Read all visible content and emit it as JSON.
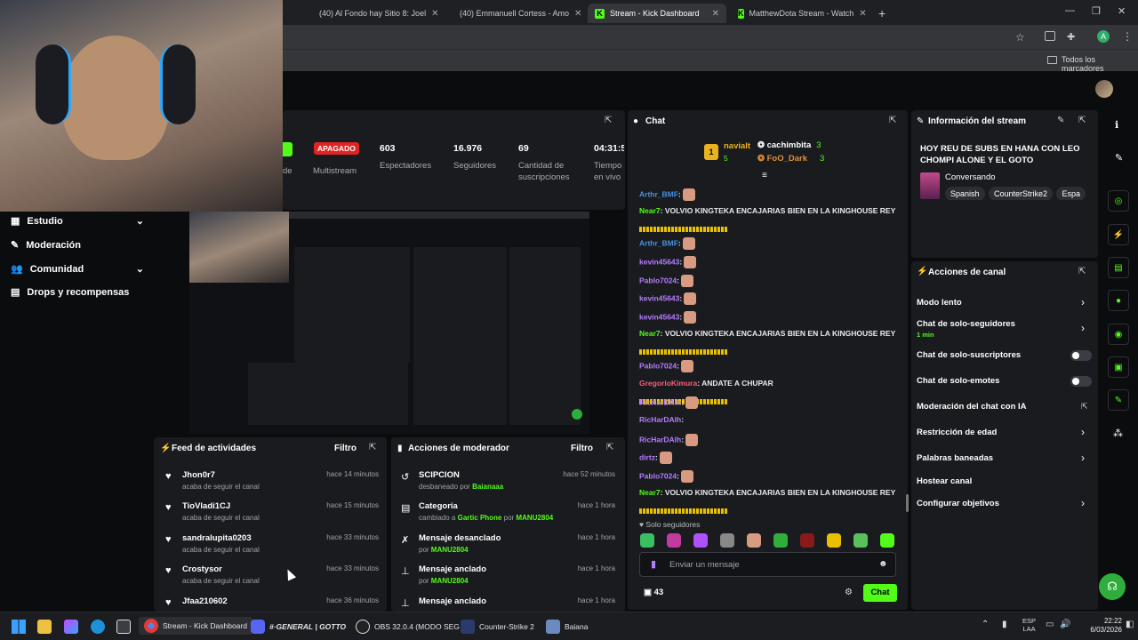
{
  "browser": {
    "tabs": [
      {
        "label": "(40) Al Fondo hay Sitio 8: Joel",
        "icon": "youtube-icon"
      },
      {
        "label": "(40) Emmanuell Cortess - Amo",
        "icon": "youtube-icon"
      },
      {
        "label": "Stream - Kick Dashboard",
        "icon": "kick-icon"
      },
      {
        "label": "MatthewDota Stream - Watch",
        "icon": "kick-icon"
      }
    ],
    "new_tab": "+",
    "bookmarks_label": "Todos los marcadores",
    "profile_initial": "A"
  },
  "stats": {
    "status_badge": "APAGADO",
    "multistream_label": "Multistream",
    "partial_label": "de",
    "viewers_value": "603",
    "viewers_label": "Espectadores",
    "followers_value": "16.976",
    "followers_label": "Seguidores",
    "subs_value": "69",
    "subs_label": "Cantidad de suscripciones",
    "time_value": "04:31:5",
    "time_label": "Tiempo en vivo"
  },
  "sidebar": {
    "items": [
      {
        "label": "Estudio",
        "icon": "studio-icon",
        "chevron": "⌄"
      },
      {
        "label": "Moderación",
        "icon": "wrench-icon"
      },
      {
        "label": "Comunidad",
        "icon": "people-icon",
        "chevron": "⌄"
      },
      {
        "label": "Drops y recompensas",
        "icon": "gift-icon"
      }
    ]
  },
  "chat": {
    "title": "Chat",
    "leaderboard": [
      {
        "rank": "1",
        "name": "navialt",
        "count": "5"
      },
      {
        "name": "cachimbita",
        "count": "3"
      },
      {
        "name": "FoO_Dark",
        "count": "3"
      }
    ],
    "messages": [
      {
        "user": "Arthr_BMF",
        "color": "#4a90e2",
        "text": ":",
        "emote": "hand"
      },
      {
        "user": "Near7",
        "color": "#53fc18",
        "text": ": VOLVIO KINGTEKA ENCAJARIAS BIEN EN LA KINGHOUSE REY"
      },
      {
        "user": "Arthr_BMF",
        "color": "#4a90e2",
        "text": ":",
        "emote": "hand"
      },
      {
        "user": "kevin45643",
        "color": "#b57cff",
        "text": ":",
        "emote": "hand"
      },
      {
        "user": "Pablo7024",
        "color": "#b57cff",
        "text": ":",
        "emote": "hand"
      },
      {
        "user": "kevin45643",
        "color": "#b57cff",
        "text": ":",
        "emote": "hand"
      },
      {
        "user": "kevin45643",
        "color": "#b57cff",
        "text": ":",
        "emote": "hand"
      },
      {
        "user": "Near7",
        "color": "#53fc18",
        "text": ": VOLVIO KINGTEKA ENCAJARIAS BIEN EN LA KINGHOUSE REY"
      },
      {
        "user": "Pablo7024",
        "color": "#b57cff",
        "text": ":",
        "emote": "hand"
      },
      {
        "user": "GregorioKimura",
        "color": "#ff5a7a",
        "text": ": ANDATE A CHUPAR"
      },
      {
        "user": "RicHarDAlh",
        "color": "#b57cff",
        "text": ":",
        "emote": "hand"
      },
      {
        "user": "RicHarDAlh",
        "color": "#b57cff",
        "text": ":"
      },
      {
        "user": "RicHarDAlh",
        "color": "#b57cff",
        "text": ":",
        "emote": "hand"
      },
      {
        "user": "dirtz",
        "color": "#b57cff",
        "text": ":",
        "emote": "hand"
      },
      {
        "user": "Pablo7024",
        "color": "#b57cff",
        "text": ":",
        "emote": "hand"
      },
      {
        "user": "Near7",
        "color": "#53fc18",
        "text": ": VOLVIO KINGTEKA ENCAJARIAS BIEN EN LA KINGHOUSE REY"
      }
    ],
    "followers_only": "Solo seguidores",
    "input_placeholder": "Enviar un mensaje",
    "viewer_count": "43",
    "send_label": "Chat"
  },
  "stream_info": {
    "title": "Información del stream",
    "stream_title": "HOY REU DE SUBS EN HANA CON LEO CHOMPI ALONE Y EL GOTO",
    "category": "Conversando",
    "tags": [
      "Spanish",
      "CounterStrike2",
      "Espa"
    ]
  },
  "channel_actions": {
    "title": "Acciones de canal",
    "items": [
      {
        "label": "Modo lento",
        "control": "chevron"
      },
      {
        "label": "Chat de solo-seguidores",
        "sub": "1 min",
        "control": "chevron"
      },
      {
        "label": "Chat de solo-suscriptores",
        "control": "toggle"
      },
      {
        "label": "Chat de solo-emotes",
        "control": "toggle"
      },
      {
        "label": "Moderación del chat con IA",
        "control": "external"
      },
      {
        "label": "Restricción de edad",
        "control": "chevron"
      },
      {
        "label": "Palabras baneadas",
        "control": "chevron"
      },
      {
        "label": "Hostear canal",
        "control": "none"
      },
      {
        "label": "Configurar objetivos",
        "control": "chevron"
      }
    ]
  },
  "activity_feed": {
    "title": "Feed de actividades",
    "filter": "Filtro",
    "items": [
      {
        "user": "Jhon0r7",
        "action": "acaba de seguir el canal",
        "time": "hace 14 minutos"
      },
      {
        "user": "TioVladi1CJ",
        "action": "acaba de seguir el canal",
        "time": "hace 15 minutos"
      },
      {
        "user": "sandralupita0203",
        "action": "acaba de seguir el canal",
        "time": "hace 33 minutos"
      },
      {
        "user": "Crostysor",
        "action": "acaba de seguir el canal",
        "time": "hace 33 minutos"
      },
      {
        "user": "Jfaa210602",
        "action": "",
        "time": "hace 36 minutos"
      }
    ]
  },
  "mod_actions": {
    "title": "Acciones de moderador",
    "filter": "Filtro",
    "items": [
      {
        "title": "SCIPCION",
        "pre": "desbaneado por",
        "a": "Baianaaa",
        "mid": "",
        "b": "",
        "time": "hace 52 minutos"
      },
      {
        "title": "Categoría",
        "pre": "cambiado a",
        "a": "Gartic Phone",
        "mid": "por",
        "b": "MANU2804",
        "time": "hace 1 hora"
      },
      {
        "title": "Mensaje desanclado",
        "pre": "por",
        "a": "MANU2804",
        "mid": "",
        "b": "",
        "time": "hace 1 hora"
      },
      {
        "title": "Mensaje anclado",
        "pre": "por",
        "a": "MANU2804",
        "mid": "",
        "b": "",
        "time": "hace 1 hora"
      },
      {
        "title": "Mensaje anclado",
        "pre": "",
        "a": "",
        "mid": "",
        "b": "",
        "time": "hace 1 hora"
      }
    ]
  },
  "taskbar": {
    "apps": [
      {
        "label": "Stream - Kick Dashboard"
      },
      {
        "label": "#·GENERAL | GOTTO"
      },
      {
        "label": "OBS 32.0.4 (MODO SEG"
      },
      {
        "label": "Counter-Strike 2"
      },
      {
        "label": "Baiana"
      }
    ],
    "lang": "ESP",
    "lang2": "LAA",
    "time": "22:22",
    "date": "6/03/2026"
  }
}
